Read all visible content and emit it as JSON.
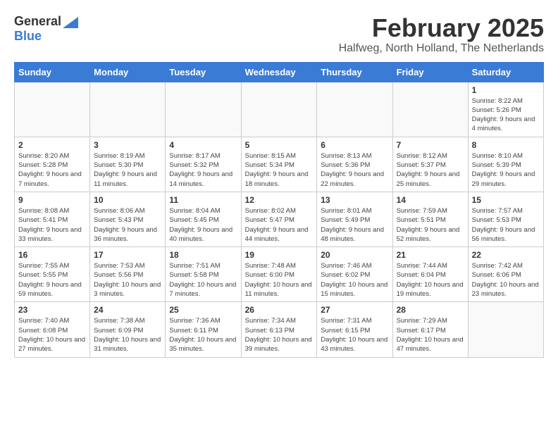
{
  "logo": {
    "general": "General",
    "blue": "Blue"
  },
  "title": "February 2025",
  "location": "Halfweg, North Holland, The Netherlands",
  "weekdays": [
    "Sunday",
    "Monday",
    "Tuesday",
    "Wednesday",
    "Thursday",
    "Friday",
    "Saturday"
  ],
  "weeks": [
    [
      {
        "day": "",
        "info": ""
      },
      {
        "day": "",
        "info": ""
      },
      {
        "day": "",
        "info": ""
      },
      {
        "day": "",
        "info": ""
      },
      {
        "day": "",
        "info": ""
      },
      {
        "day": "",
        "info": ""
      },
      {
        "day": "1",
        "info": "Sunrise: 8:22 AM\nSunset: 5:26 PM\nDaylight: 9 hours and 4 minutes."
      }
    ],
    [
      {
        "day": "2",
        "info": "Sunrise: 8:20 AM\nSunset: 5:28 PM\nDaylight: 9 hours and 7 minutes."
      },
      {
        "day": "3",
        "info": "Sunrise: 8:19 AM\nSunset: 5:30 PM\nDaylight: 9 hours and 11 minutes."
      },
      {
        "day": "4",
        "info": "Sunrise: 8:17 AM\nSunset: 5:32 PM\nDaylight: 9 hours and 14 minutes."
      },
      {
        "day": "5",
        "info": "Sunrise: 8:15 AM\nSunset: 5:34 PM\nDaylight: 9 hours and 18 minutes."
      },
      {
        "day": "6",
        "info": "Sunrise: 8:13 AM\nSunset: 5:36 PM\nDaylight: 9 hours and 22 minutes."
      },
      {
        "day": "7",
        "info": "Sunrise: 8:12 AM\nSunset: 5:37 PM\nDaylight: 9 hours and 25 minutes."
      },
      {
        "day": "8",
        "info": "Sunrise: 8:10 AM\nSunset: 5:39 PM\nDaylight: 9 hours and 29 minutes."
      }
    ],
    [
      {
        "day": "9",
        "info": "Sunrise: 8:08 AM\nSunset: 5:41 PM\nDaylight: 9 hours and 33 minutes."
      },
      {
        "day": "10",
        "info": "Sunrise: 8:06 AM\nSunset: 5:43 PM\nDaylight: 9 hours and 36 minutes."
      },
      {
        "day": "11",
        "info": "Sunrise: 8:04 AM\nSunset: 5:45 PM\nDaylight: 9 hours and 40 minutes."
      },
      {
        "day": "12",
        "info": "Sunrise: 8:02 AM\nSunset: 5:47 PM\nDaylight: 9 hours and 44 minutes."
      },
      {
        "day": "13",
        "info": "Sunrise: 8:01 AM\nSunset: 5:49 PM\nDaylight: 9 hours and 48 minutes."
      },
      {
        "day": "14",
        "info": "Sunrise: 7:59 AM\nSunset: 5:51 PM\nDaylight: 9 hours and 52 minutes."
      },
      {
        "day": "15",
        "info": "Sunrise: 7:57 AM\nSunset: 5:53 PM\nDaylight: 9 hours and 56 minutes."
      }
    ],
    [
      {
        "day": "16",
        "info": "Sunrise: 7:55 AM\nSunset: 5:55 PM\nDaylight: 9 hours and 59 minutes."
      },
      {
        "day": "17",
        "info": "Sunrise: 7:53 AM\nSunset: 5:56 PM\nDaylight: 10 hours and 3 minutes."
      },
      {
        "day": "18",
        "info": "Sunrise: 7:51 AM\nSunset: 5:58 PM\nDaylight: 10 hours and 7 minutes."
      },
      {
        "day": "19",
        "info": "Sunrise: 7:48 AM\nSunset: 6:00 PM\nDaylight: 10 hours and 11 minutes."
      },
      {
        "day": "20",
        "info": "Sunrise: 7:46 AM\nSunset: 6:02 PM\nDaylight: 10 hours and 15 minutes."
      },
      {
        "day": "21",
        "info": "Sunrise: 7:44 AM\nSunset: 6:04 PM\nDaylight: 10 hours and 19 minutes."
      },
      {
        "day": "22",
        "info": "Sunrise: 7:42 AM\nSunset: 6:06 PM\nDaylight: 10 hours and 23 minutes."
      }
    ],
    [
      {
        "day": "23",
        "info": "Sunrise: 7:40 AM\nSunset: 6:08 PM\nDaylight: 10 hours and 27 minutes."
      },
      {
        "day": "24",
        "info": "Sunrise: 7:38 AM\nSunset: 6:09 PM\nDaylight: 10 hours and 31 minutes."
      },
      {
        "day": "25",
        "info": "Sunrise: 7:36 AM\nSunset: 6:11 PM\nDaylight: 10 hours and 35 minutes."
      },
      {
        "day": "26",
        "info": "Sunrise: 7:34 AM\nSunset: 6:13 PM\nDaylight: 10 hours and 39 minutes."
      },
      {
        "day": "27",
        "info": "Sunrise: 7:31 AM\nSunset: 6:15 PM\nDaylight: 10 hours and 43 minutes."
      },
      {
        "day": "28",
        "info": "Sunrise: 7:29 AM\nSunset: 6:17 PM\nDaylight: 10 hours and 47 minutes."
      },
      {
        "day": "",
        "info": ""
      }
    ]
  ]
}
